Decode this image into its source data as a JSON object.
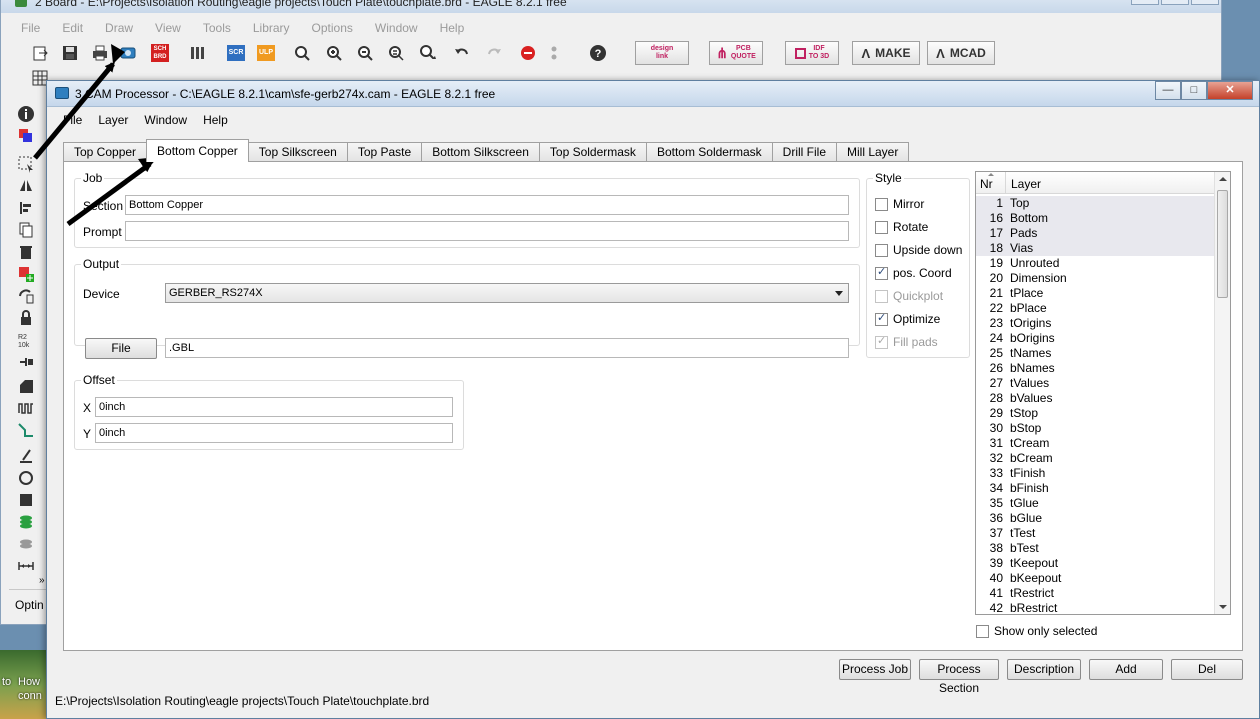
{
  "board_window": {
    "title": "2 Board - E:\\Projects\\Isolation Routing\\eagle projects\\Touch Plate\\touchplate.brd - EAGLE 8.2.1 free",
    "menu": [
      "File",
      "Edit",
      "Draw",
      "View",
      "Tools",
      "Library",
      "Options",
      "Window",
      "Help"
    ],
    "toolbar_buttons": {
      "design_link_top": "design",
      "design_link_bottom": "link",
      "pcb_quote_top": "PCB",
      "pcb_quote_bottom": "QUOTE",
      "idf_top": "IDF",
      "idf_bottom": "TO 3D",
      "make": "MAKE",
      "mcad": "MCAD",
      "sch_brd_top": "SCH",
      "sch_brd_bottom": "BRD",
      "scr": "SCR",
      "ulp": "ULP"
    },
    "bottom_label": "Optin",
    "desktop_text_1": "to",
    "desktop_text_2": "How",
    "desktop_text_3": "conn"
  },
  "cam_window": {
    "title": "3 CAM Processor - C:\\EAGLE 8.2.1\\cam\\sfe-gerb274x.cam - EAGLE 8.2.1 free",
    "controls": {
      "minimize": "—",
      "maximize": "□",
      "close": "✕"
    },
    "menu": [
      "File",
      "Layer",
      "Window",
      "Help"
    ],
    "tabs": [
      "Top Copper",
      "Bottom Copper",
      "Top Silkscreen",
      "Top Paste",
      "Bottom Silkscreen",
      "Top Soldermask",
      "Bottom Soldermask",
      "Drill File",
      "Mill Layer"
    ],
    "active_tab": "Bottom Copper",
    "job": {
      "group_label": "Job",
      "section_label": "Section",
      "section_value": "Bottom Copper",
      "prompt_label": "Prompt",
      "prompt_value": ""
    },
    "output": {
      "group_label": "Output",
      "device_label": "Device",
      "device_value": "GERBER_RS274X",
      "file_button": "File",
      "file_value": ".GBL"
    },
    "offset": {
      "group_label": "Offset",
      "x_label": "X",
      "x_value": "0inch",
      "y_label": "Y",
      "y_value": "0inch"
    },
    "style": {
      "group_label": "Style",
      "options": [
        {
          "label": "Mirror",
          "checked": false,
          "enabled": true
        },
        {
          "label": "Rotate",
          "checked": false,
          "enabled": true
        },
        {
          "label": "Upside down",
          "checked": false,
          "enabled": true
        },
        {
          "label": "pos. Coord",
          "checked": true,
          "enabled": true
        },
        {
          "label": "Quickplot",
          "checked": false,
          "enabled": false
        },
        {
          "label": "Optimize",
          "checked": true,
          "enabled": true
        },
        {
          "label": "Fill pads",
          "checked": true,
          "enabled": false
        }
      ]
    },
    "layers": {
      "col_nr": "Nr",
      "col_layer": "Layer",
      "rows": [
        {
          "nr": "1",
          "name": "Top",
          "selected": true
        },
        {
          "nr": "16",
          "name": "Bottom",
          "selected": true
        },
        {
          "nr": "17",
          "name": "Pads",
          "selected": true
        },
        {
          "nr": "18",
          "name": "Vias",
          "selected": true
        },
        {
          "nr": "19",
          "name": "Unrouted",
          "selected": false
        },
        {
          "nr": "20",
          "name": "Dimension",
          "selected": false
        },
        {
          "nr": "21",
          "name": "tPlace",
          "selected": false
        },
        {
          "nr": "22",
          "name": "bPlace",
          "selected": false
        },
        {
          "nr": "23",
          "name": "tOrigins",
          "selected": false
        },
        {
          "nr": "24",
          "name": "bOrigins",
          "selected": false
        },
        {
          "nr": "25",
          "name": "tNames",
          "selected": false
        },
        {
          "nr": "26",
          "name": "bNames",
          "selected": false
        },
        {
          "nr": "27",
          "name": "tValues",
          "selected": false
        },
        {
          "nr": "28",
          "name": "bValues",
          "selected": false
        },
        {
          "nr": "29",
          "name": "tStop",
          "selected": false
        },
        {
          "nr": "30",
          "name": "bStop",
          "selected": false
        },
        {
          "nr": "31",
          "name": "tCream",
          "selected": false
        },
        {
          "nr": "32",
          "name": "bCream",
          "selected": false
        },
        {
          "nr": "33",
          "name": "tFinish",
          "selected": false
        },
        {
          "nr": "34",
          "name": "bFinish",
          "selected": false
        },
        {
          "nr": "35",
          "name": "tGlue",
          "selected": false
        },
        {
          "nr": "36",
          "name": "bGlue",
          "selected": false
        },
        {
          "nr": "37",
          "name": "tTest",
          "selected": false
        },
        {
          "nr": "38",
          "name": "bTest",
          "selected": false
        },
        {
          "nr": "39",
          "name": "tKeepout",
          "selected": false
        },
        {
          "nr": "40",
          "name": "bKeepout",
          "selected": false
        },
        {
          "nr": "41",
          "name": "tRestrict",
          "selected": false
        },
        {
          "nr": "42",
          "name": "bRestrict",
          "selected": false
        }
      ],
      "show_only_selected": "Show only selected"
    },
    "buttons": {
      "process_job": "Process Job",
      "process_section": "Process Section",
      "description": "Description",
      "add": "Add",
      "del": "Del"
    },
    "status_path": "E:\\Projects\\Isolation Routing\\eagle projects\\Touch Plate\\touchplate.brd"
  },
  "colors": {
    "annotation_arrow": "#000000",
    "close_button": "#c4412a",
    "titlebar": "#c5d7eb"
  }
}
